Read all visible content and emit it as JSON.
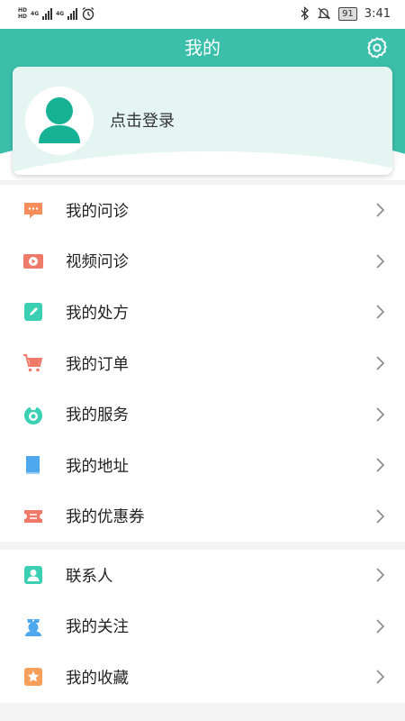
{
  "status_bar": {
    "network_left": "HD",
    "network_left_2": "HD",
    "net_type_1": "4G",
    "net_type_2": "4G",
    "battery": "91",
    "time": "3:41"
  },
  "header": {
    "title": "我的",
    "settings_icon": "gear-icon"
  },
  "profile": {
    "login_label": "点击登录",
    "avatar_icon": "user-avatar-icon"
  },
  "colors": {
    "brand": "#3bbfab",
    "orange": "#f88c5a",
    "teal_icon": "#3bcfb4",
    "blue_icon": "#4da8f0",
    "red_icon": "#f07a6a"
  },
  "menu_group_1": [
    {
      "label": "我的问诊",
      "icon": "chat-bubble-icon"
    },
    {
      "label": "视频问诊",
      "icon": "video-play-icon"
    },
    {
      "label": "我的处方",
      "icon": "edit-pencil-icon"
    },
    {
      "label": "我的订单",
      "icon": "shopping-cart-icon"
    },
    {
      "label": "我的服务",
      "icon": "medal-icon"
    },
    {
      "label": "我的地址",
      "icon": "book-icon"
    },
    {
      "label": "我的优惠券",
      "icon": "coupon-ticket-icon"
    }
  ],
  "menu_group_2": [
    {
      "label": "联系人",
      "icon": "contact-card-icon"
    },
    {
      "label": "我的关注",
      "icon": "nurse-icon"
    },
    {
      "label": "我的收藏",
      "icon": "star-icon"
    }
  ]
}
